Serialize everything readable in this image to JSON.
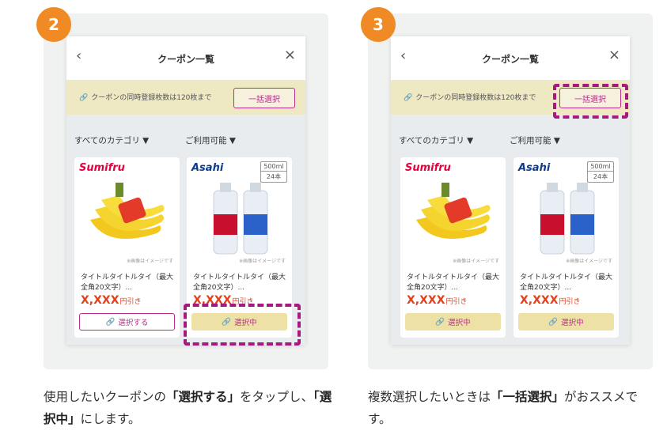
{
  "steps": [
    {
      "number": "2",
      "phone": {
        "title": "クーポン一覧",
        "back_icon": "‹",
        "close_icon": "×",
        "notice": "クーポンの同時登録枚数は120枚まで",
        "bulk_label": "一括選択",
        "filter_category": "すべてのカテゴリ ▼",
        "filter_available": "ご利用可能 ▼",
        "cards": [
          {
            "brand": "Sumifru",
            "image_note": "※画像はイメージです",
            "name": "タイトルタイトルタイ（最大全角20文字）...",
            "price": "X,XXX",
            "price_unit": "円引き",
            "button": "選択する"
          },
          {
            "brand": "Asahi",
            "spec": [
              "500ml",
              "24本"
            ],
            "image_note": "※画像はイメージです",
            "name": "タイトルタイトルタイ（最大全角20文字）...",
            "price": "X,XXX",
            "price_unit": "円引き",
            "button": "選択中"
          }
        ]
      },
      "caption_parts": [
        "使用したいクーポンの",
        "「選択する」",
        "をタップし、",
        "「選択中」",
        "にします。"
      ]
    },
    {
      "number": "3",
      "phone": {
        "title": "クーポン一覧",
        "back_icon": "‹",
        "close_icon": "×",
        "notice": "クーポンの同時登録枚数は120枚まで",
        "bulk_label": "一括選択",
        "filter_category": "すべてのカテゴリ ▼",
        "filter_available": "ご利用可能 ▼",
        "cards": [
          {
            "brand": "Sumifru",
            "image_note": "※画像はイメージです",
            "name": "タイトルタイトルタイ（最大全角20文字）...",
            "price": "X,XXX",
            "price_unit": "円引き",
            "button": "選択中"
          },
          {
            "brand": "Asahi",
            "spec": [
              "500ml",
              "24本"
            ],
            "image_note": "※画像はイメージです",
            "name": "タイトルタイトルタイ（最大全角20文字）...",
            "price": "X,XXX",
            "price_unit": "円引き",
            "button": "選択中"
          }
        ]
      },
      "caption_parts": [
        "複数選択したいときは",
        "「一括選択」",
        "がおススメです。"
      ]
    }
  ],
  "colors": {
    "badge": "#f08a24",
    "accent": "#b82e8a",
    "price": "#e2411b",
    "notice_bg": "#eee8c3"
  },
  "icons": [
    "chevron-left-icon",
    "close-icon",
    "paperclip-icon"
  ]
}
